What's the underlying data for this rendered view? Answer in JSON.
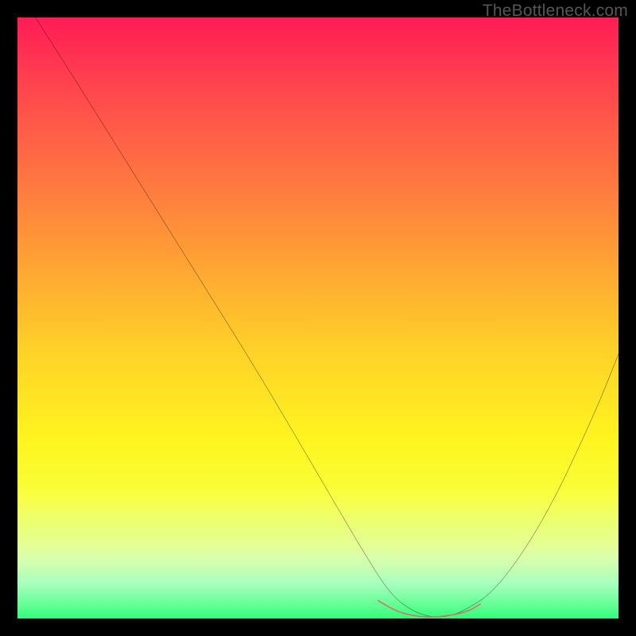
{
  "watermark": "TheBottleneck.com",
  "chart_data": {
    "type": "line",
    "title": "",
    "xlabel": "",
    "ylabel": "",
    "xlim": [
      0,
      100
    ],
    "ylim": [
      0,
      100
    ],
    "grid": false,
    "series": [
      {
        "name": "curve",
        "x": [
          3,
          10,
          20,
          30,
          40,
          50,
          57,
          62,
          66,
          70,
          74,
          80,
          88,
          96,
          100
        ],
        "values": [
          100,
          89,
          73,
          57,
          41,
          24,
          12,
          4,
          1,
          0,
          1,
          5,
          17,
          34,
          44
        ]
      }
    ],
    "highlight": {
      "name": "trough",
      "color": "#d6706f",
      "x": [
        60,
        63,
        66,
        69,
        72,
        75,
        77
      ],
      "values": [
        3.0,
        1.2,
        0.4,
        0.2,
        0.5,
        1.2,
        2.4
      ]
    }
  }
}
